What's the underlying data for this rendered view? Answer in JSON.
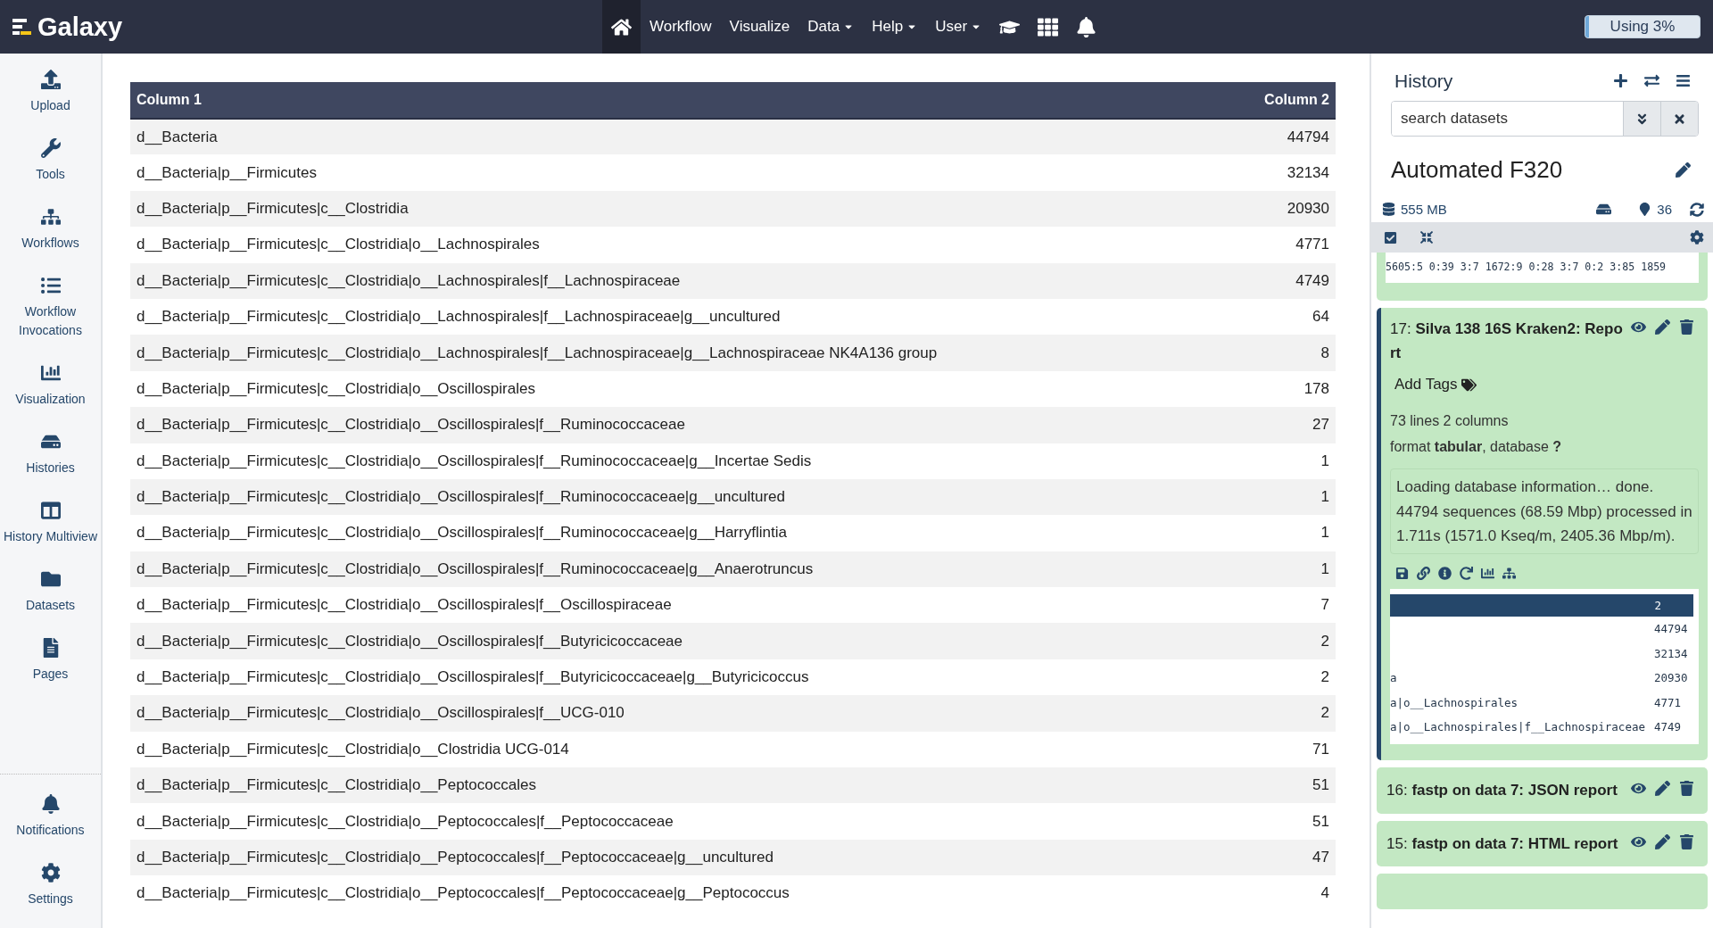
{
  "brand": {
    "name": "Galaxy"
  },
  "nav": [
    {
      "kind": "icon",
      "selected": true
    },
    {
      "kind": "text",
      "label": "Workflow",
      "selected": false
    },
    {
      "kind": "text",
      "label": "Visualize",
      "selected": false
    },
    {
      "kind": "dropdown",
      "label": "Data",
      "selected": false
    },
    {
      "kind": "dropdown",
      "label": "Help",
      "selected": false
    },
    {
      "kind": "dropdown",
      "label": "User",
      "selected": false
    },
    {
      "kind": "icon",
      "selected": false
    },
    {
      "kind": "icon",
      "selected": false
    },
    {
      "kind": "icon",
      "selected": false
    }
  ],
  "usage": {
    "label": "Using 3%",
    "level": 0.03
  },
  "sidebar": {
    "items": [
      {
        "label": "Upload"
      },
      {
        "label": "Tools"
      },
      {
        "label": "Workflows"
      },
      {
        "label": "Workflow Invocations"
      },
      {
        "label": "Visualization"
      },
      {
        "label": "Histories"
      },
      {
        "label": "History Multiview"
      },
      {
        "label": "Datasets"
      },
      {
        "label": "Pages"
      }
    ],
    "bottom_items": [
      {
        "label": "Notifications"
      },
      {
        "label": "Settings"
      }
    ]
  },
  "table": {
    "columns": [
      "Column 1",
      "Column 2"
    ],
    "rows": [
      [
        "d__Bacteria",
        "44794"
      ],
      [
        "d__Bacteria|p__Firmicutes",
        "32134"
      ],
      [
        "d__Bacteria|p__Firmicutes|c__Clostridia",
        "20930"
      ],
      [
        "d__Bacteria|p__Firmicutes|c__Clostridia|o__Lachnospirales",
        "4771"
      ],
      [
        "d__Bacteria|p__Firmicutes|c__Clostridia|o__Lachnospirales|f__Lachnospiraceae",
        "4749"
      ],
      [
        "d__Bacteria|p__Firmicutes|c__Clostridia|o__Lachnospirales|f__Lachnospiraceae|g__uncultured",
        "64"
      ],
      [
        "d__Bacteria|p__Firmicutes|c__Clostridia|o__Lachnospirales|f__Lachnospiraceae|g__Lachnospiraceae NK4A136 group",
        "8"
      ],
      [
        "d__Bacteria|p__Firmicutes|c__Clostridia|o__Oscillospirales",
        "178"
      ],
      [
        "d__Bacteria|p__Firmicutes|c__Clostridia|o__Oscillospirales|f__Ruminococcaceae",
        "27"
      ],
      [
        "d__Bacteria|p__Firmicutes|c__Clostridia|o__Oscillospirales|f__Ruminococcaceae|g__Incertae Sedis",
        "1"
      ],
      [
        "d__Bacteria|p__Firmicutes|c__Clostridia|o__Oscillospirales|f__Ruminococcaceae|g__uncultured",
        "1"
      ],
      [
        "d__Bacteria|p__Firmicutes|c__Clostridia|o__Oscillospirales|f__Ruminococcaceae|g__Harryflintia",
        "1"
      ],
      [
        "d__Bacteria|p__Firmicutes|c__Clostridia|o__Oscillospirales|f__Ruminococcaceae|g__Anaerotruncus",
        "1"
      ],
      [
        "d__Bacteria|p__Firmicutes|c__Clostridia|o__Oscillospirales|f__Oscillospiraceae",
        "7"
      ],
      [
        "d__Bacteria|p__Firmicutes|c__Clostridia|o__Oscillospirales|f__Butyricicoccaceae",
        "2"
      ],
      [
        "d__Bacteria|p__Firmicutes|c__Clostridia|o__Oscillospirales|f__Butyricicoccaceae|g__Butyricicoccus",
        "2"
      ],
      [
        "d__Bacteria|p__Firmicutes|c__Clostridia|o__Oscillospirales|f__UCG-010",
        "2"
      ],
      [
        "d__Bacteria|p__Firmicutes|c__Clostridia|o__Clostridia UCG-014",
        "71"
      ],
      [
        "d__Bacteria|p__Firmicutes|c__Clostridia|o__Peptococcales",
        "51"
      ],
      [
        "d__Bacteria|p__Firmicutes|c__Clostridia|o__Peptococcales|f__Peptococcaceae",
        "51"
      ],
      [
        "d__Bacteria|p__Firmicutes|c__Clostridia|o__Peptococcales|f__Peptococcaceae|g__uncultured",
        "47"
      ],
      [
        "d__Bacteria|p__Firmicutes|c__Clostridia|o__Peptococcales|f__Peptococcaceae|g__Peptococcus",
        "4"
      ]
    ]
  },
  "history": {
    "title": "History",
    "search": {
      "placeholder": "search datasets"
    },
    "name": "Automated F320",
    "size": "555 MB",
    "count": "36",
    "peek_text": "5605:5 0:39 3:7 1672:9 0:28 3:7 0:2 3:85 1859",
    "expanded": {
      "hid": "17:",
      "name": "Silva 138 16S Kraken2: Report",
      "tags_label": "Add Tags",
      "lines": "73 lines 2 columns",
      "format": "format **tabular**,  database **?**",
      "info": "Loading database information… done. 44794 sequences (68.59 Mbp) processed in 1.711s (1571.0 Kseq/m, 2405.36 Mbp/m).",
      "preview": {
        "header": "2",
        "rows": [
          [
            "",
            "44794"
          ],
          [
            "",
            "32134"
          ],
          [
            "a",
            "20930"
          ],
          [
            "a|o__Lachnospirales",
            "4771"
          ],
          [
            "a|o__Lachnospirales|f__Lachnospiraceae",
            "4749"
          ]
        ]
      }
    },
    "items": [
      {
        "hid": "16:",
        "name": "fastp on data 7: JSON report"
      },
      {
        "hid": "15:",
        "name": "fastp on data 7: HTML report"
      }
    ]
  }
}
